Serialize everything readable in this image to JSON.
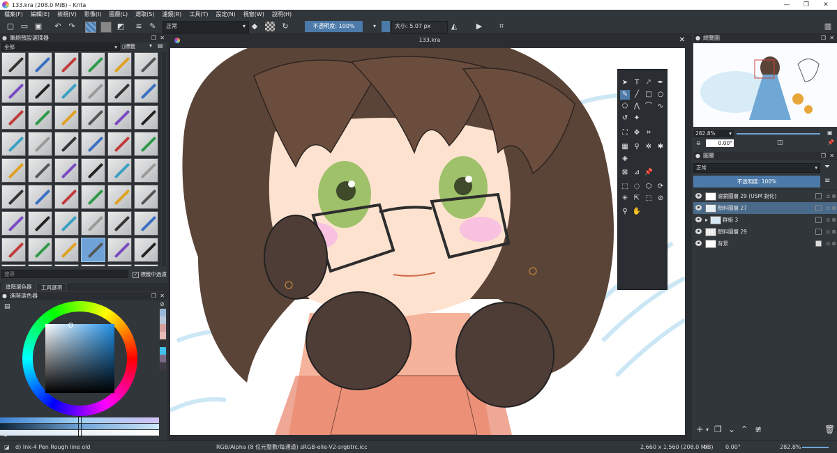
{
  "window": {
    "title": "133.kra (208.0 MiB) - Krita",
    "min_glyph": "—",
    "max_glyph": "❐",
    "close_glyph": "✕"
  },
  "menu": [
    "檔案(F)",
    "編輯(E)",
    "檢視(V)",
    "影像(I)",
    "圖層(L)",
    "選取(S)",
    "濾鏡(R)",
    "工具(T)",
    "設定(N)",
    "視窗(W)",
    "說明(H)"
  ],
  "toolbar": {
    "blend_mode": "正常",
    "opacity": "不透明度: 100%",
    "size": "大小: 5.07 px"
  },
  "brush_presets": {
    "title": "筆刷預設選擇器",
    "filter": "全部",
    "tag_label": "標籤",
    "search_placeholder": "搜尋",
    "filter_in_tag": "標籤中過濾"
  },
  "tabs": {
    "advanced_color": "進階選色器",
    "tool_options": "工具選項"
  },
  "color_selector": {
    "title": "進階選色器"
  },
  "document": {
    "tab_title": "133.kra"
  },
  "overview": {
    "title": "總覽圖",
    "zoom": "282.8%",
    "rotation": "0.00°"
  },
  "layers": {
    "title": "圖層",
    "blend_mode": "正常",
    "opacity": "不透明度: 100%",
    "items": [
      {
        "name": "濾鏡圖層 29 (USM 銳化)",
        "selected": false
      },
      {
        "name": "顏料圖層 27",
        "selected": true
      },
      {
        "name": "群組 3",
        "selected": false
      },
      {
        "name": "顏料圖層 29",
        "selected": false
      },
      {
        "name": "背景",
        "selected": false
      }
    ]
  },
  "status": {
    "brush_name": "d) Ink-4 Pen Rough line old",
    "color_profile": "RGB/Alpha (8 位元整數/每通道)  sRGB-elle-V2-srgbtrc.icc",
    "image_size": "2,660 x 1,560 (208.0 MiB)",
    "rotation": "0.00°",
    "zoom": "282.8%"
  },
  "colors": {
    "accent": "#4b7aa8",
    "selected_layer": "#4a6a8a",
    "panel_bg": "#31363b"
  }
}
